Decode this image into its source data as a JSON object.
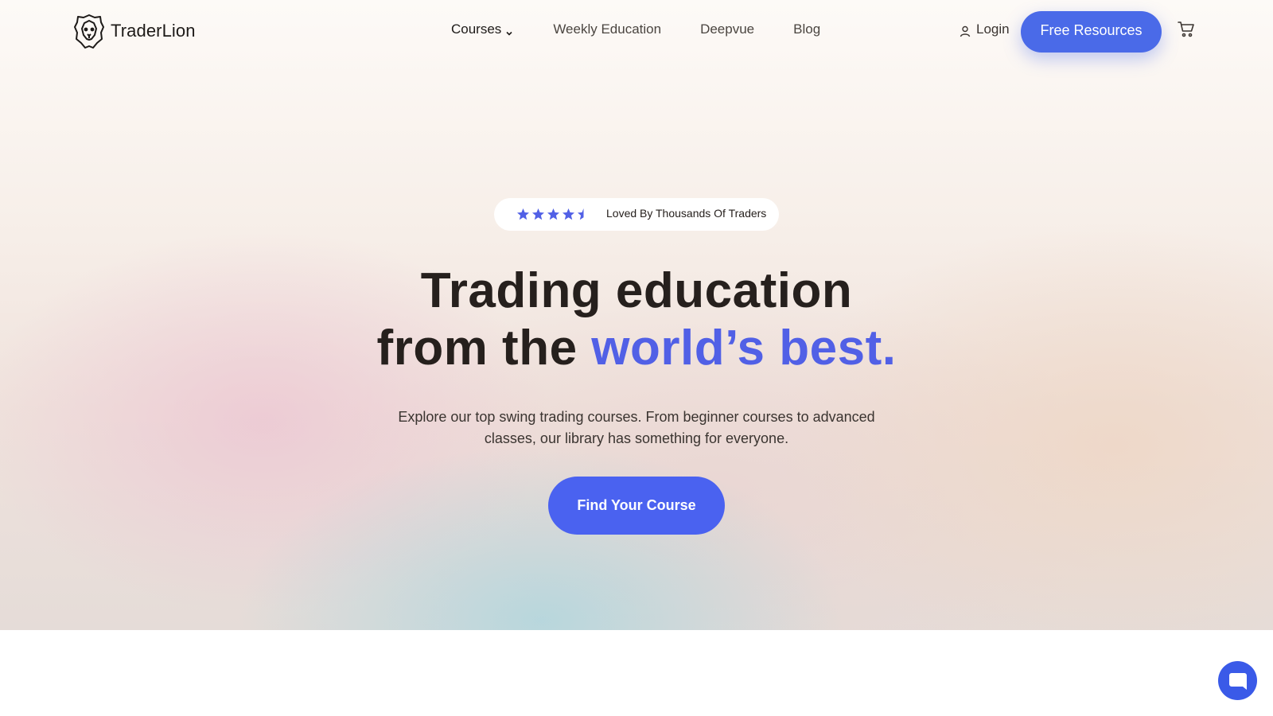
{
  "brand": {
    "name": "TraderLion"
  },
  "nav": {
    "items": [
      {
        "label": "Courses"
      },
      {
        "label": "Weekly Education"
      },
      {
        "label": "Deepvue"
      },
      {
        "label": "Blog"
      }
    ],
    "login_label": "Login",
    "free_resources_label": "Free Resources"
  },
  "hero": {
    "rating_text": "Loved By Thousands Of Traders",
    "rating_stars": 4.5,
    "headline_line1": "Trading education",
    "headline_line2_prefix": "from the ",
    "headline_line2_accent": "world’s best.",
    "subtitle_line1": "Explore our top swing trading courses. From beginner courses to advanced",
    "subtitle_line2": "classes, our library has something for everyone.",
    "cta_label": "Find Your Course"
  },
  "icons": {
    "logo": "lion-head-icon",
    "courses_dropdown": "chevron-down-icon",
    "login": "user-icon",
    "cart": "cart-icon",
    "chat": "chat-bubble-icon",
    "star": "star-icon"
  },
  "colors": {
    "accent": "#5160e6",
    "button": "#4a6ae8",
    "cta": "#4a62f0",
    "text": "#26201d"
  }
}
